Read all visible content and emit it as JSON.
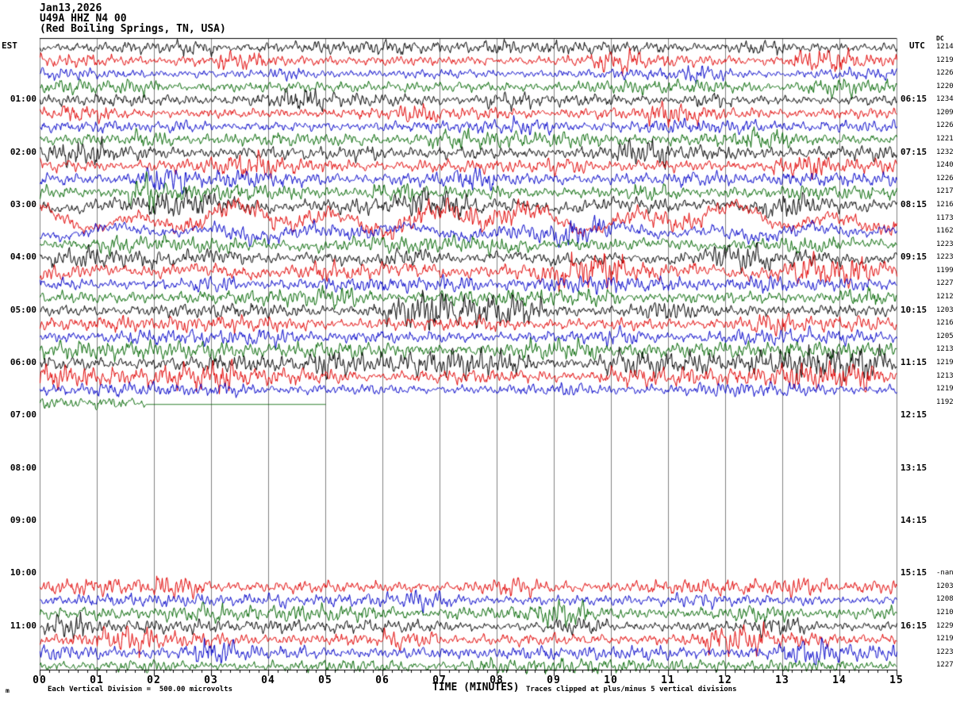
{
  "header": {
    "date": "Jan13,2026",
    "station": "U49A HHZ N4 00",
    "location": "(Red Boiling Springs, TN, USA)"
  },
  "footer": {
    "division_note": "Each Vertical Division =  500.00 microvolts",
    "clip_note": "Traces clipped at plus/minus 5 vertical divisions",
    "mark": "m"
  },
  "colors": {
    "black": "#000000",
    "red": "#e00000",
    "blue": "#0000c8",
    "green": "#006600",
    "grid": "#808080",
    "axis": "#000000"
  },
  "chart_data": {
    "type": "line",
    "subtype": "helicorder-seismogram",
    "title": "U49A HHZ N4 00 (Red Boiling Springs, TN, USA) Jan13,2026",
    "xlabel": "TIME (MINUTES)",
    "x_range": [
      0,
      15
    ],
    "minutes_per_row": 15,
    "x_ticks": [
      "00",
      "01",
      "02",
      "03",
      "04",
      "05",
      "06",
      "07",
      "08",
      "09",
      "10",
      "11",
      "12",
      "13",
      "14",
      "15"
    ],
    "left_header": "EST",
    "right_header": "UTC",
    "dc_header": "DC",
    "division_microvolts": 500,
    "clip_divisions": 5,
    "grid": true,
    "est_hour_labels": [
      "01:00",
      "02:00",
      "03:00",
      "04:00",
      "05:00",
      "06:00",
      "07:00",
      "08:00",
      "09:00",
      "10:00",
      "11:00"
    ],
    "utc_hour_labels": [
      "06:15",
      "07:15",
      "08:15",
      "09:15",
      "10:15",
      "11:15",
      "12:15",
      "13:15",
      "14:15",
      "15:15",
      "16:15"
    ],
    "rows": [
      {
        "dc": "1214",
        "trace": 1,
        "amp": 6,
        "bursts": [
          [
            2.4,
            3.1,
            1.9
          ],
          [
            7.3,
            8.3,
            1.8
          ],
          [
            12.2,
            13,
            1.6
          ]
        ]
      },
      {
        "dc": "1219",
        "trace": 1,
        "amp": 6,
        "bursts": [
          [
            3.1,
            3.9,
            1.7
          ],
          [
            9.7,
            10.5,
            1.9
          ],
          [
            13.2,
            14.2,
            1.7
          ]
        ]
      },
      {
        "dc": "1226",
        "trace": 1,
        "amp": 5,
        "bursts": [
          [
            4,
            4.6,
            1.6
          ],
          [
            11.3,
            12,
            1.8
          ]
        ]
      },
      {
        "dc": "1220",
        "trace": 1,
        "amp": 6,
        "bursts": [
          [
            1.4,
            2.1,
            1.7
          ],
          [
            5.2,
            5.8,
            1.5
          ],
          [
            13.4,
            14.3,
            1.6
          ]
        ]
      },
      {
        "dc": "1234",
        "trace": 1,
        "amp": 6,
        "bursts": [
          [
            4.2,
            5,
            1.8
          ],
          [
            7.8,
            8.6,
            1.7
          ],
          [
            11.5,
            12.1,
            2
          ]
        ]
      },
      {
        "dc": "1209",
        "trace": 1,
        "amp": 6,
        "bursts": [
          [
            0.3,
            1.2,
            1.6
          ],
          [
            6.3,
            7,
            1.5
          ],
          [
            10.6,
            11.6,
            1.7
          ]
        ]
      },
      {
        "dc": "1226",
        "trace": 1,
        "amp": 6,
        "bursts": [
          [
            2.2,
            3,
            1.6
          ],
          [
            8.2,
            9,
            1.6
          ],
          [
            13.5,
            14.5,
            1.5
          ]
        ]
      },
      {
        "dc": "1221",
        "trace": 1,
        "amp": 7,
        "bursts": [
          [
            1.6,
            2.3,
            1.7
          ],
          [
            6.8,
            7.5,
            1.5
          ],
          [
            12.3,
            13.2,
            1.6
          ]
        ]
      },
      {
        "dc": "1232",
        "trace": 1,
        "amp": 7,
        "bursts": [
          [
            0.4,
            1.1,
            1.6
          ],
          [
            5.4,
            6.2,
            1.6
          ],
          [
            10.1,
            11,
            1.8
          ]
        ]
      },
      {
        "dc": "1240",
        "trace": 1,
        "amp": 7,
        "bursts": [
          [
            3.3,
            4.1,
            1.6
          ],
          [
            8.8,
            9.6,
            1.7
          ],
          [
            12.8,
            13.8,
            1.8
          ]
        ]
      },
      {
        "dc": "1226",
        "trace": 1,
        "amp": 7,
        "bursts": [
          [
            1.7,
            2.6,
            1.9
          ],
          [
            7.2,
            8,
            1.6
          ],
          [
            11.2,
            12.2,
            1.6
          ]
        ]
      },
      {
        "dc": "1217",
        "trace": 1,
        "amp": 7,
        "bursts": [
          [
            1.5,
            2,
            3
          ],
          [
            5.8,
            6.6,
            1.6
          ],
          [
            10.4,
            11.2,
            1.5
          ]
        ]
      },
      {
        "dc": "1216",
        "trace": 1,
        "amp": 8,
        "lf": 4,
        "bursts": [
          [
            2,
            3,
            1.5
          ],
          [
            6.5,
            7.5,
            1.5
          ],
          [
            12.6,
            13.6,
            1.7
          ]
        ]
      },
      {
        "dc": "1173",
        "trace": 1,
        "amp": 8,
        "lf": 16,
        "bursts": [
          [
            4,
            12,
            1.3
          ]
        ]
      },
      {
        "dc": "1162",
        "trace": 1,
        "amp": 7,
        "lf": 7,
        "bursts": [
          [
            3,
            4,
            1.5
          ],
          [
            9,
            10,
            1.5
          ]
        ]
      },
      {
        "dc": "1223",
        "trace": 1,
        "amp": 7,
        "lf": 3,
        "bursts": [
          [
            1,
            1.8,
            1.5
          ],
          [
            7.8,
            8.6,
            1.5
          ],
          [
            13,
            14,
            1.5
          ]
        ]
      },
      {
        "dc": "1223",
        "trace": 1,
        "amp": 7,
        "lf": 3,
        "bursts": [
          [
            0.2,
            1,
            1.8
          ],
          [
            6,
            7,
            1.6
          ],
          [
            11.8,
            12.8,
            1.8
          ]
        ]
      },
      {
        "dc": "1199",
        "trace": 1,
        "amp": 8,
        "lf": 4,
        "bursts": [
          [
            4.4,
            5.2,
            1.6
          ],
          [
            9,
            10.2,
            1.9
          ],
          [
            13.2,
            14.6,
            1.9
          ]
        ]
      },
      {
        "dc": "1227",
        "trace": 1,
        "amp": 7,
        "bursts": [
          [
            2.6,
            3.4,
            1.6
          ],
          [
            7,
            7.8,
            1.5
          ],
          [
            12,
            13,
            1.6
          ]
        ]
      },
      {
        "dc": "1212",
        "trace": 1,
        "amp": 7,
        "bursts": [
          [
            4.8,
            5.6,
            1.6
          ],
          [
            9.4,
            10.2,
            1.6
          ],
          [
            14,
            14.8,
            1.5
          ]
        ]
      },
      {
        "dc": "1203",
        "trace": 1,
        "amp": 7,
        "bursts": [
          [
            6,
            8.8,
            2.2
          ],
          [
            10.6,
            11.4,
            1.6
          ]
        ]
      },
      {
        "dc": "1216",
        "trace": 1,
        "amp": 7,
        "bursts": [
          [
            0.8,
            1.6,
            1.5
          ],
          [
            7.6,
            8.4,
            1.5
          ],
          [
            12.4,
            13.2,
            1.6
          ]
        ]
      },
      {
        "dc": "1205",
        "trace": 1,
        "amp": 7,
        "bursts": [
          [
            3.6,
            4.4,
            1.5
          ],
          [
            9.8,
            10.6,
            1.6
          ]
        ]
      },
      {
        "dc": "1213",
        "trace": 1,
        "amp": 8,
        "bursts": [
          [
            2.8,
            3.6,
            1.7
          ],
          [
            8.4,
            9.8,
            1.8
          ],
          [
            13,
            14.2,
            1.7
          ]
        ]
      },
      {
        "dc": "1219",
        "trace": 1,
        "amp": 7,
        "bursts": [
          [
            4.8,
            8.6,
            2.3
          ],
          [
            9.8,
            14.8,
            2.2
          ]
        ]
      },
      {
        "dc": "1213",
        "trace": 1,
        "amp": 7,
        "bursts": [
          [
            0,
            3.4,
            1.9
          ],
          [
            9.8,
            14.6,
            1.9
          ]
        ]
      },
      {
        "dc": "1219",
        "trace": 1,
        "amp": 6,
        "bursts": [
          [
            3,
            3.8,
            1.4
          ],
          [
            9,
            10,
            1.4
          ]
        ]
      },
      {
        "dc": "1192",
        "trace": 1,
        "amp": 6,
        "bursts": [
          [
            0.9,
            1.5,
            1.6
          ]
        ],
        "flat_from": 1.85,
        "span": [
          0,
          5
        ]
      },
      {
        "dc": null,
        "trace": 0
      },
      {
        "dc": null,
        "trace": 0
      },
      {
        "dc": null,
        "trace": 0
      },
      {
        "dc": null,
        "trace": 0
      },
      {
        "dc": null,
        "trace": 0
      },
      {
        "dc": null,
        "trace": 0
      },
      {
        "dc": null,
        "trace": 0
      },
      {
        "dc": null,
        "trace": 0
      },
      {
        "dc": null,
        "trace": 0
      },
      {
        "dc": null,
        "trace": 0
      },
      {
        "dc": null,
        "trace": 0
      },
      {
        "dc": null,
        "trace": 0
      },
      {
        "dc": "-nan",
        "trace": 0
      },
      {
        "dc": "1203",
        "trace": 1,
        "amp": 7,
        "bursts": [
          [
            2,
            2.8,
            1.6
          ],
          [
            7.9,
            8.8,
            1.8
          ],
          [
            13,
            13.9,
            1.7
          ]
        ]
      },
      {
        "dc": "1208",
        "trace": 1,
        "amp": 6,
        "bursts": [
          [
            3.5,
            4.3,
            1.7
          ],
          [
            6.4,
            7.2,
            1.6
          ],
          [
            10.8,
            11.8,
            1.7
          ]
        ]
      },
      {
        "dc": "1210",
        "trace": 1,
        "amp": 7,
        "bursts": [
          [
            2.2,
            3.2,
            1.7
          ],
          [
            8.7,
            9.6,
            1.8
          ],
          [
            12.1,
            13.1,
            1.6
          ]
        ]
      },
      {
        "dc": "1229",
        "trace": 1,
        "amp": 6,
        "bursts": [
          [
            0.05,
            0.85,
            2.6
          ],
          [
            3.6,
            4.6,
            1.7
          ],
          [
            9,
            10,
            1.8
          ],
          [
            12.6,
            13.4,
            1.7
          ]
        ]
      },
      {
        "dc": "1219",
        "trace": 1,
        "amp": 7,
        "bursts": [
          [
            1,
            2,
            1.7
          ],
          [
            6,
            7,
            1.6
          ],
          [
            11.6,
            12.8,
            1.8
          ]
        ]
      },
      {
        "dc": "1223",
        "trace": 1,
        "amp": 7,
        "bursts": [
          [
            2.7,
            3.4,
            2
          ],
          [
            8,
            9,
            1.6
          ],
          [
            12.9,
            13.8,
            1.7
          ]
        ]
      },
      {
        "dc": "1227",
        "trace": 1,
        "amp": 6,
        "bursts": [
          [
            1.3,
            2.2,
            1.5
          ],
          [
            7.4,
            8.2,
            1.5
          ],
          [
            11,
            12,
            1.5
          ]
        ]
      }
    ]
  }
}
